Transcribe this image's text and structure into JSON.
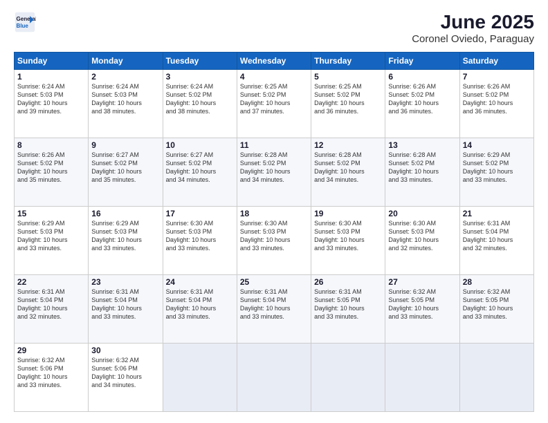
{
  "header": {
    "logo_line1": "General",
    "logo_line2": "Blue",
    "month": "June 2025",
    "location": "Coronel Oviedo, Paraguay"
  },
  "weekdays": [
    "Sunday",
    "Monday",
    "Tuesday",
    "Wednesday",
    "Thursday",
    "Friday",
    "Saturday"
  ],
  "weeks": [
    [
      {
        "day": "1",
        "info": "Sunrise: 6:24 AM\nSunset: 5:03 PM\nDaylight: 10 hours\nand 39 minutes."
      },
      {
        "day": "2",
        "info": "Sunrise: 6:24 AM\nSunset: 5:03 PM\nDaylight: 10 hours\nand 38 minutes."
      },
      {
        "day": "3",
        "info": "Sunrise: 6:24 AM\nSunset: 5:02 PM\nDaylight: 10 hours\nand 38 minutes."
      },
      {
        "day": "4",
        "info": "Sunrise: 6:25 AM\nSunset: 5:02 PM\nDaylight: 10 hours\nand 37 minutes."
      },
      {
        "day": "5",
        "info": "Sunrise: 6:25 AM\nSunset: 5:02 PM\nDaylight: 10 hours\nand 36 minutes."
      },
      {
        "day": "6",
        "info": "Sunrise: 6:26 AM\nSunset: 5:02 PM\nDaylight: 10 hours\nand 36 minutes."
      },
      {
        "day": "7",
        "info": "Sunrise: 6:26 AM\nSunset: 5:02 PM\nDaylight: 10 hours\nand 36 minutes."
      }
    ],
    [
      {
        "day": "8",
        "info": "Sunrise: 6:26 AM\nSunset: 5:02 PM\nDaylight: 10 hours\nand 35 minutes."
      },
      {
        "day": "9",
        "info": "Sunrise: 6:27 AM\nSunset: 5:02 PM\nDaylight: 10 hours\nand 35 minutes."
      },
      {
        "day": "10",
        "info": "Sunrise: 6:27 AM\nSunset: 5:02 PM\nDaylight: 10 hours\nand 34 minutes."
      },
      {
        "day": "11",
        "info": "Sunrise: 6:28 AM\nSunset: 5:02 PM\nDaylight: 10 hours\nand 34 minutes."
      },
      {
        "day": "12",
        "info": "Sunrise: 6:28 AM\nSunset: 5:02 PM\nDaylight: 10 hours\nand 34 minutes."
      },
      {
        "day": "13",
        "info": "Sunrise: 6:28 AM\nSunset: 5:02 PM\nDaylight: 10 hours\nand 33 minutes."
      },
      {
        "day": "14",
        "info": "Sunrise: 6:29 AM\nSunset: 5:02 PM\nDaylight: 10 hours\nand 33 minutes."
      }
    ],
    [
      {
        "day": "15",
        "info": "Sunrise: 6:29 AM\nSunset: 5:03 PM\nDaylight: 10 hours\nand 33 minutes."
      },
      {
        "day": "16",
        "info": "Sunrise: 6:29 AM\nSunset: 5:03 PM\nDaylight: 10 hours\nand 33 minutes."
      },
      {
        "day": "17",
        "info": "Sunrise: 6:30 AM\nSunset: 5:03 PM\nDaylight: 10 hours\nand 33 minutes."
      },
      {
        "day": "18",
        "info": "Sunrise: 6:30 AM\nSunset: 5:03 PM\nDaylight: 10 hours\nand 33 minutes."
      },
      {
        "day": "19",
        "info": "Sunrise: 6:30 AM\nSunset: 5:03 PM\nDaylight: 10 hours\nand 33 minutes."
      },
      {
        "day": "20",
        "info": "Sunrise: 6:30 AM\nSunset: 5:03 PM\nDaylight: 10 hours\nand 32 minutes."
      },
      {
        "day": "21",
        "info": "Sunrise: 6:31 AM\nSunset: 5:04 PM\nDaylight: 10 hours\nand 32 minutes."
      }
    ],
    [
      {
        "day": "22",
        "info": "Sunrise: 6:31 AM\nSunset: 5:04 PM\nDaylight: 10 hours\nand 32 minutes."
      },
      {
        "day": "23",
        "info": "Sunrise: 6:31 AM\nSunset: 5:04 PM\nDaylight: 10 hours\nand 33 minutes."
      },
      {
        "day": "24",
        "info": "Sunrise: 6:31 AM\nSunset: 5:04 PM\nDaylight: 10 hours\nand 33 minutes."
      },
      {
        "day": "25",
        "info": "Sunrise: 6:31 AM\nSunset: 5:04 PM\nDaylight: 10 hours\nand 33 minutes."
      },
      {
        "day": "26",
        "info": "Sunrise: 6:31 AM\nSunset: 5:05 PM\nDaylight: 10 hours\nand 33 minutes."
      },
      {
        "day": "27",
        "info": "Sunrise: 6:32 AM\nSunset: 5:05 PM\nDaylight: 10 hours\nand 33 minutes."
      },
      {
        "day": "28",
        "info": "Sunrise: 6:32 AM\nSunset: 5:05 PM\nDaylight: 10 hours\nand 33 minutes."
      }
    ],
    [
      {
        "day": "29",
        "info": "Sunrise: 6:32 AM\nSunset: 5:06 PM\nDaylight: 10 hours\nand 33 minutes."
      },
      {
        "day": "30",
        "info": "Sunrise: 6:32 AM\nSunset: 5:06 PM\nDaylight: 10 hours\nand 34 minutes."
      },
      {
        "day": "",
        "info": ""
      },
      {
        "day": "",
        "info": ""
      },
      {
        "day": "",
        "info": ""
      },
      {
        "day": "",
        "info": ""
      },
      {
        "day": "",
        "info": ""
      }
    ]
  ]
}
